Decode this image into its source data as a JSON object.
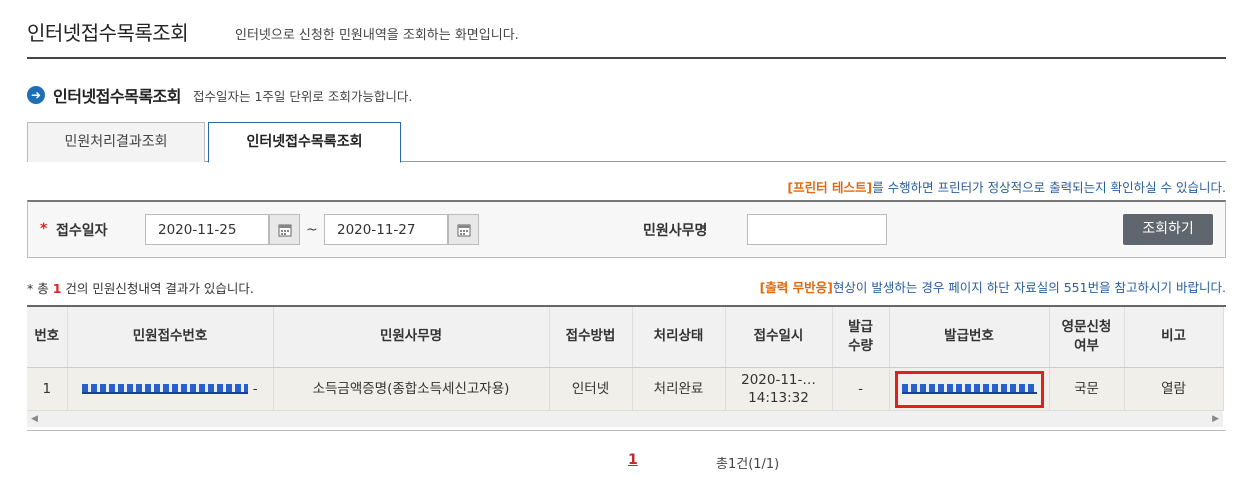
{
  "page": {
    "title": "인터넷접수목록조회",
    "description": "인터넷으로 신청한 민원내역을 조회하는 화면입니다."
  },
  "section": {
    "icon": "arrow-circle-icon",
    "title": "인터넷접수목록조회",
    "note": "접수일자는 1주일 단위로 조회가능합니다."
  },
  "tabs": [
    {
      "label": "민원처리결과조회",
      "active": false
    },
    {
      "label": "인터넷접수목록조회",
      "active": true
    }
  ],
  "printer_notice": {
    "highlight": "[프린터 테스트]",
    "text": "를 수행하면 프린터가 정상적으로 출력되는지 확인하실 수 있습니다."
  },
  "search": {
    "date_label": "접수일자",
    "required_mark": "*",
    "date_from": "2020-11-25",
    "date_to": "2020-11-27",
    "separator": "~",
    "office_label": "민원사무명",
    "office_value": "",
    "button_label": "조회하기"
  },
  "result": {
    "prefix": "* 총",
    "count": "1",
    "suffix": "건의 민원신청내역 결과가 있습니다."
  },
  "output_notice": {
    "highlight": "[출력 무반응]",
    "text": "현상이 발생하는 경우 페이지 하단 자료실의 551번을 참고하시기 바랍니다."
  },
  "table": {
    "headers": [
      "번호",
      "민원접수번호",
      "민원사무명",
      "접수방법",
      "처리상태",
      "접수일시",
      "발급\n수량",
      "발급번호",
      "영문신청\n여부",
      "비고"
    ],
    "rows": [
      {
        "no": "1",
        "receipt_suffix": "-",
        "office_name": "소득금액증명(종합소득세신고자용)",
        "method": "인터넷",
        "status": "처리완료",
        "date_line1": "2020-11-…",
        "date_line2": "14:13:32",
        "quantity": "-",
        "lang": "국문",
        "remark": "열람"
      }
    ]
  },
  "pagination": {
    "current": "1",
    "total": "총1건(1/1)"
  },
  "colors": {
    "accent_blue": "#2a67a8",
    "highlight_orange": "#e06a10",
    "alert_red": "#e0201b",
    "button_gray": "#5f666d"
  }
}
